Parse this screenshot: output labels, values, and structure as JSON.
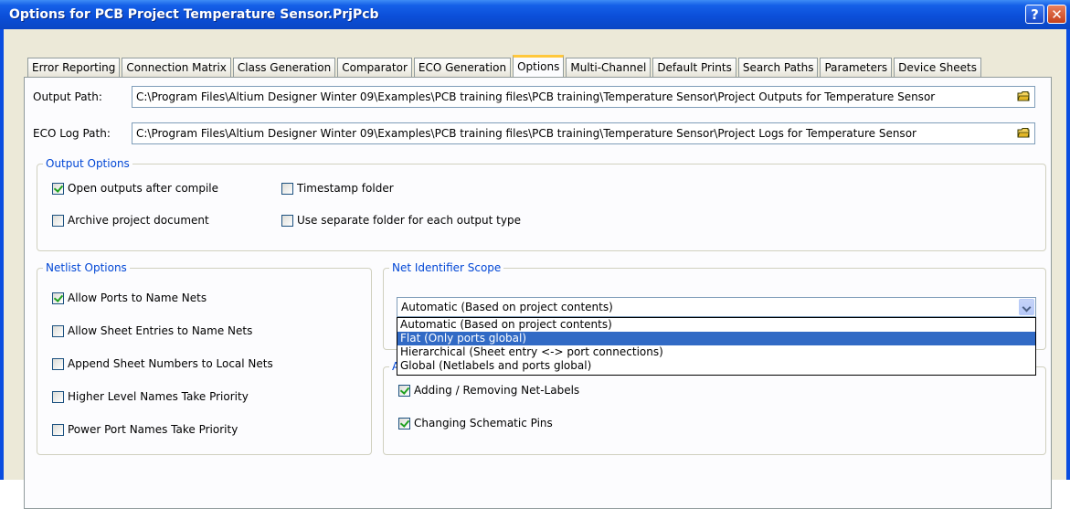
{
  "window": {
    "title": "Options for PCB Project Temperature Sensor.PrjPcb",
    "help_glyph": "?",
    "close_glyph": "✕"
  },
  "tabs": [
    {
      "label": "Error Reporting"
    },
    {
      "label": "Connection Matrix"
    },
    {
      "label": "Class Generation"
    },
    {
      "label": "Comparator"
    },
    {
      "label": "ECO Generation"
    },
    {
      "label": "Options"
    },
    {
      "label": "Multi-Channel"
    },
    {
      "label": "Default Prints"
    },
    {
      "label": "Search Paths"
    },
    {
      "label": "Parameters"
    },
    {
      "label": "Device Sheets"
    }
  ],
  "active_tab": "Options",
  "output_path": {
    "label": "Output Path:",
    "value": "C:\\Program Files\\Altium Designer Winter 09\\Examples\\PCB training files\\PCB training\\Temperature Sensor\\Project Outputs for Temperature Sensor"
  },
  "eco_log_path": {
    "label": "ECO Log Path:",
    "value": "C:\\Program Files\\Altium Designer Winter 09\\Examples\\PCB training files\\PCB training\\Temperature Sensor\\Project Logs for Temperature Sensor"
  },
  "output_options": {
    "title": "Output Options",
    "open_outputs": {
      "label": "Open outputs after compile",
      "checked": true
    },
    "timestamp_folder": {
      "label": "Timestamp folder",
      "checked": false
    },
    "archive_project": {
      "label": "Archive project document",
      "checked": false
    },
    "separate_folder": {
      "label": "Use separate folder for each output type",
      "checked": false
    }
  },
  "netlist_options": {
    "title": "Netlist Options",
    "items": [
      {
        "label": "Allow Ports to Name Nets",
        "checked": true
      },
      {
        "label": "Allow Sheet Entries to Name Nets",
        "checked": false
      },
      {
        "label": "Append Sheet Numbers to Local Nets",
        "checked": false
      },
      {
        "label": "Higher Level Names Take Priority",
        "checked": false
      },
      {
        "label": "Power Port Names Take Priority",
        "checked": false
      }
    ]
  },
  "net_identifier_scope": {
    "title": "Net Identifier Scope",
    "selected": "Automatic (Based on project contents)",
    "options": [
      "Automatic (Based on project contents)",
      "Flat (Only ports global)",
      "Hierarchical (Sheet entry <-> port connections)",
      "Global (Netlabels and ports global)"
    ],
    "highlighted_index": 1
  },
  "second_group": {
    "title_visible": "A",
    "items": [
      {
        "label": "Adding / Removing Net-Labels",
        "checked": true
      },
      {
        "label": "Changing Schematic Pins",
        "checked": true
      }
    ]
  },
  "colors": {
    "title_bar": "#0a4de0",
    "group_title": "#0046d5",
    "highlight": "#316ac5",
    "dialog_bg": "#ece9d8"
  },
  "icons": {
    "folder": "folder-icon",
    "dropdown": "chevron-down-icon",
    "help": "help-icon",
    "close": "close-icon"
  }
}
